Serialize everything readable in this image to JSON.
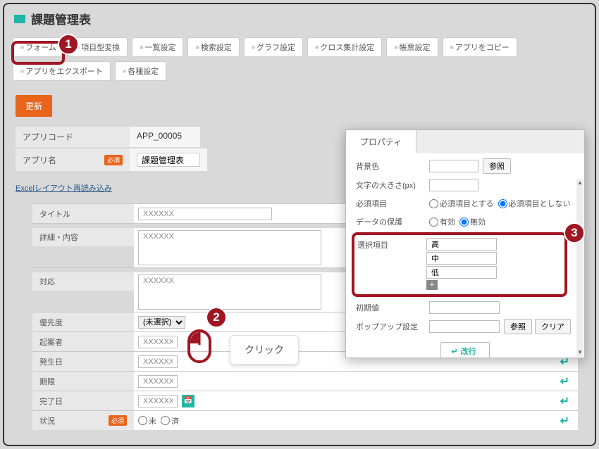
{
  "header": {
    "title": "課題管理表"
  },
  "tabs": [
    "フォーム",
    "項目型変換",
    "一覧設定",
    "検索設定",
    "グラフ設定",
    "クロス集計設定",
    "帳票設定",
    "アプリをコピー",
    "アプリをエクスポート",
    "各種設定"
  ],
  "update_btn": "更新",
  "app_code": {
    "label": "アプリコード",
    "value": "APP_00005"
  },
  "app_name": {
    "label": "アプリ名",
    "value": "課題管理表",
    "required": "必須"
  },
  "reimport_link": "Excelレイアウト再読み込み",
  "form": {
    "title": {
      "label": "タイトル",
      "value": "XXXXXX"
    },
    "detail": {
      "label": "詳細・内容",
      "value": "XXXXXX"
    },
    "response": {
      "label": "対応",
      "value": "XXXXXX"
    },
    "priority": {
      "label": "優先度",
      "value": "(未選択)"
    },
    "requester": {
      "label": "起案者",
      "value": "XXXXXX"
    },
    "start_date": {
      "label": "発生日",
      "value": "XXXXXX"
    },
    "deadline": {
      "label": "期限",
      "value": "XXXXXX"
    },
    "done_date": {
      "label": "完了日",
      "value": "XXXXXX"
    },
    "status": {
      "label": "状況",
      "opt1": "未",
      "opt2": "済",
      "required": "必須"
    }
  },
  "tooltip": "クリック",
  "panel": {
    "tab": "プロパティ",
    "bgcolor": {
      "label": "背景色",
      "btn": "参照"
    },
    "fontsize": {
      "label": "文字の大きさ(px)"
    },
    "required": {
      "label": "必須項目",
      "opt1": "必須項目とする",
      "opt2": "必須項目としない"
    },
    "data": {
      "label": "データの保護",
      "opt1": "有効",
      "opt2": "無効"
    },
    "select": {
      "label": "選択項目",
      "items": [
        "高",
        "中",
        "低"
      ]
    },
    "initval": {
      "label": "初期値"
    },
    "popup": {
      "label": "ポップアップ設定",
      "btn1": "参照",
      "btn2": "クリア"
    },
    "newline_btn": "改行"
  }
}
